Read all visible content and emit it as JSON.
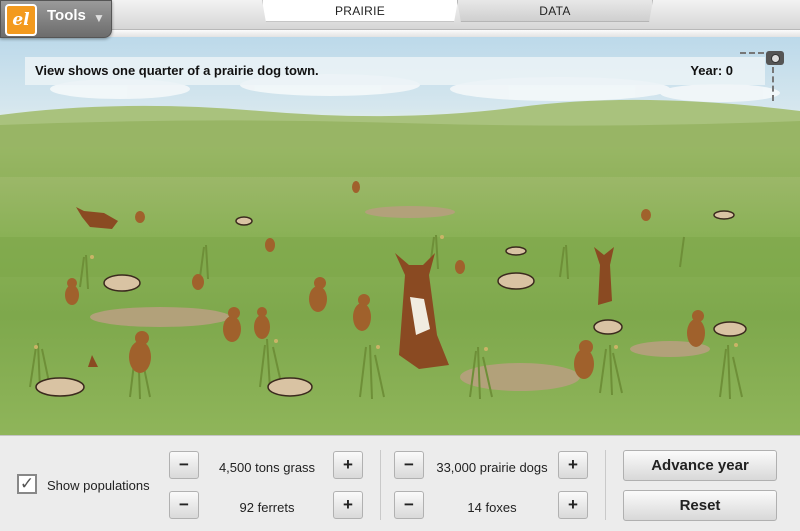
{
  "header": {
    "tools_label": "Tools",
    "logo_text": "el",
    "tabs": [
      {
        "label": "PRAIRIE",
        "active": true
      },
      {
        "label": "DATA",
        "active": false
      }
    ]
  },
  "scene": {
    "view_text": "View shows one quarter of a prairie dog town.",
    "year_label": "Year: 0"
  },
  "controls": {
    "show_populations": {
      "label": "Show populations",
      "checked": true,
      "mark": "✓"
    },
    "grass": {
      "minus": "−",
      "value": "4,500 tons grass",
      "plus": "+"
    },
    "ferrets": {
      "minus": "−",
      "value": "92 ferrets",
      "plus": "+"
    },
    "prairie_dogs": {
      "minus": "−",
      "value": "33,000 prairie dogs",
      "plus": "+"
    },
    "foxes": {
      "minus": "−",
      "value": "14 foxes",
      "plus": "+"
    },
    "advance_label": "Advance year",
    "reset_label": "Reset"
  },
  "colors": {
    "logo_orange": "#f39a1e",
    "grass_green": "#8ab156",
    "prairie_dog_brown": "#a0612c",
    "fox_brown": "#8a4a22",
    "ferret_tan": "#d9c3a3"
  },
  "icons": [
    "explorelearning-logo-icon",
    "chevron-down-icon",
    "camera-icon",
    "check-icon"
  ]
}
